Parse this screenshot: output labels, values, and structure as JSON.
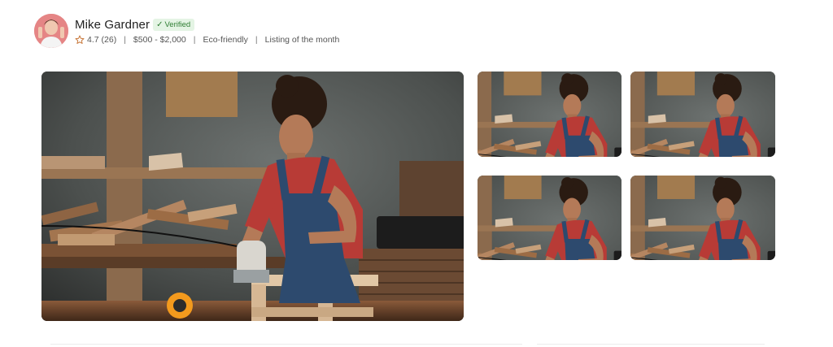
{
  "profile": {
    "name": "Mike Gardner",
    "verified_label": "Verified",
    "rating": "4.7 (26)",
    "price_range": "$500 - $2,000",
    "tag_eco": "Eco-friendly",
    "tag_listing": "Listing of the month",
    "separator": "|"
  },
  "gallery": {
    "main_alt": "Woman in red shirt and denim overalls sanding wood in a workshop",
    "thumb_alt": "Woman sanding wood in a workshop"
  },
  "colors": {
    "verified_bg": "#e4f4e4",
    "verified_text": "#2e7d32",
    "star": "#c8773a"
  },
  "icons": [
    "avatar",
    "check-icon",
    "star-icon"
  ]
}
